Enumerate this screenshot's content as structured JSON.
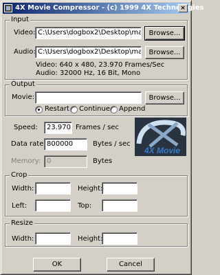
{
  "window": {
    "title": "4X Movie Compressor - (c) 1999 4X Technologies",
    "close_glyph": "×"
  },
  "input": {
    "legend": "Input",
    "video_label": "Video:",
    "video_path": "C:\\Users\\dogbox2\\Desktop\\manoftaic",
    "audio_label": "Audio:",
    "audio_path": "C:\\Users\\dogbox2\\Desktop\\manoftaic",
    "browse_label": "Browse...",
    "video_info": "Video: 640 x 480, 23.970 Frames/Sec",
    "audio_info": "Audio: 32000 Hz, 16 Bit, Mono"
  },
  "output": {
    "legend": "Output",
    "movie_label": "Movie:",
    "movie_path": "",
    "browse_label": "Browse...",
    "mode_options": [
      "Restart",
      "Continue",
      "Append"
    ],
    "mode_selected": "Restart"
  },
  "settings": {
    "speed_label": "Speed:",
    "speed_value": "23.970",
    "speed_unit": "Frames / sec",
    "datarate_label": "Data rate:",
    "datarate_value": "800000",
    "datarate_unit": "Bytes / sec",
    "memory_label": "Memory:",
    "memory_value": "0",
    "memory_unit": "Bytes"
  },
  "logo": {
    "text": "4X Movie"
  },
  "crop": {
    "legend": "Crop",
    "width_label": "Width:",
    "height_label": "Height:",
    "left_label": "Left:",
    "top_label": "Top:",
    "width_value": "",
    "height_value": "",
    "left_value": "",
    "top_value": ""
  },
  "resize": {
    "legend": "Resize",
    "width_label": "Width:",
    "height_label": "Height:",
    "width_value": "",
    "height_value": ""
  },
  "buttons": {
    "ok": "OK",
    "cancel": "Cancel"
  },
  "colors": {
    "title_start": "#0a246a",
    "title_end": "#a6caf0",
    "face": "#d4d0c8",
    "logo_text": "#3a78c8"
  }
}
